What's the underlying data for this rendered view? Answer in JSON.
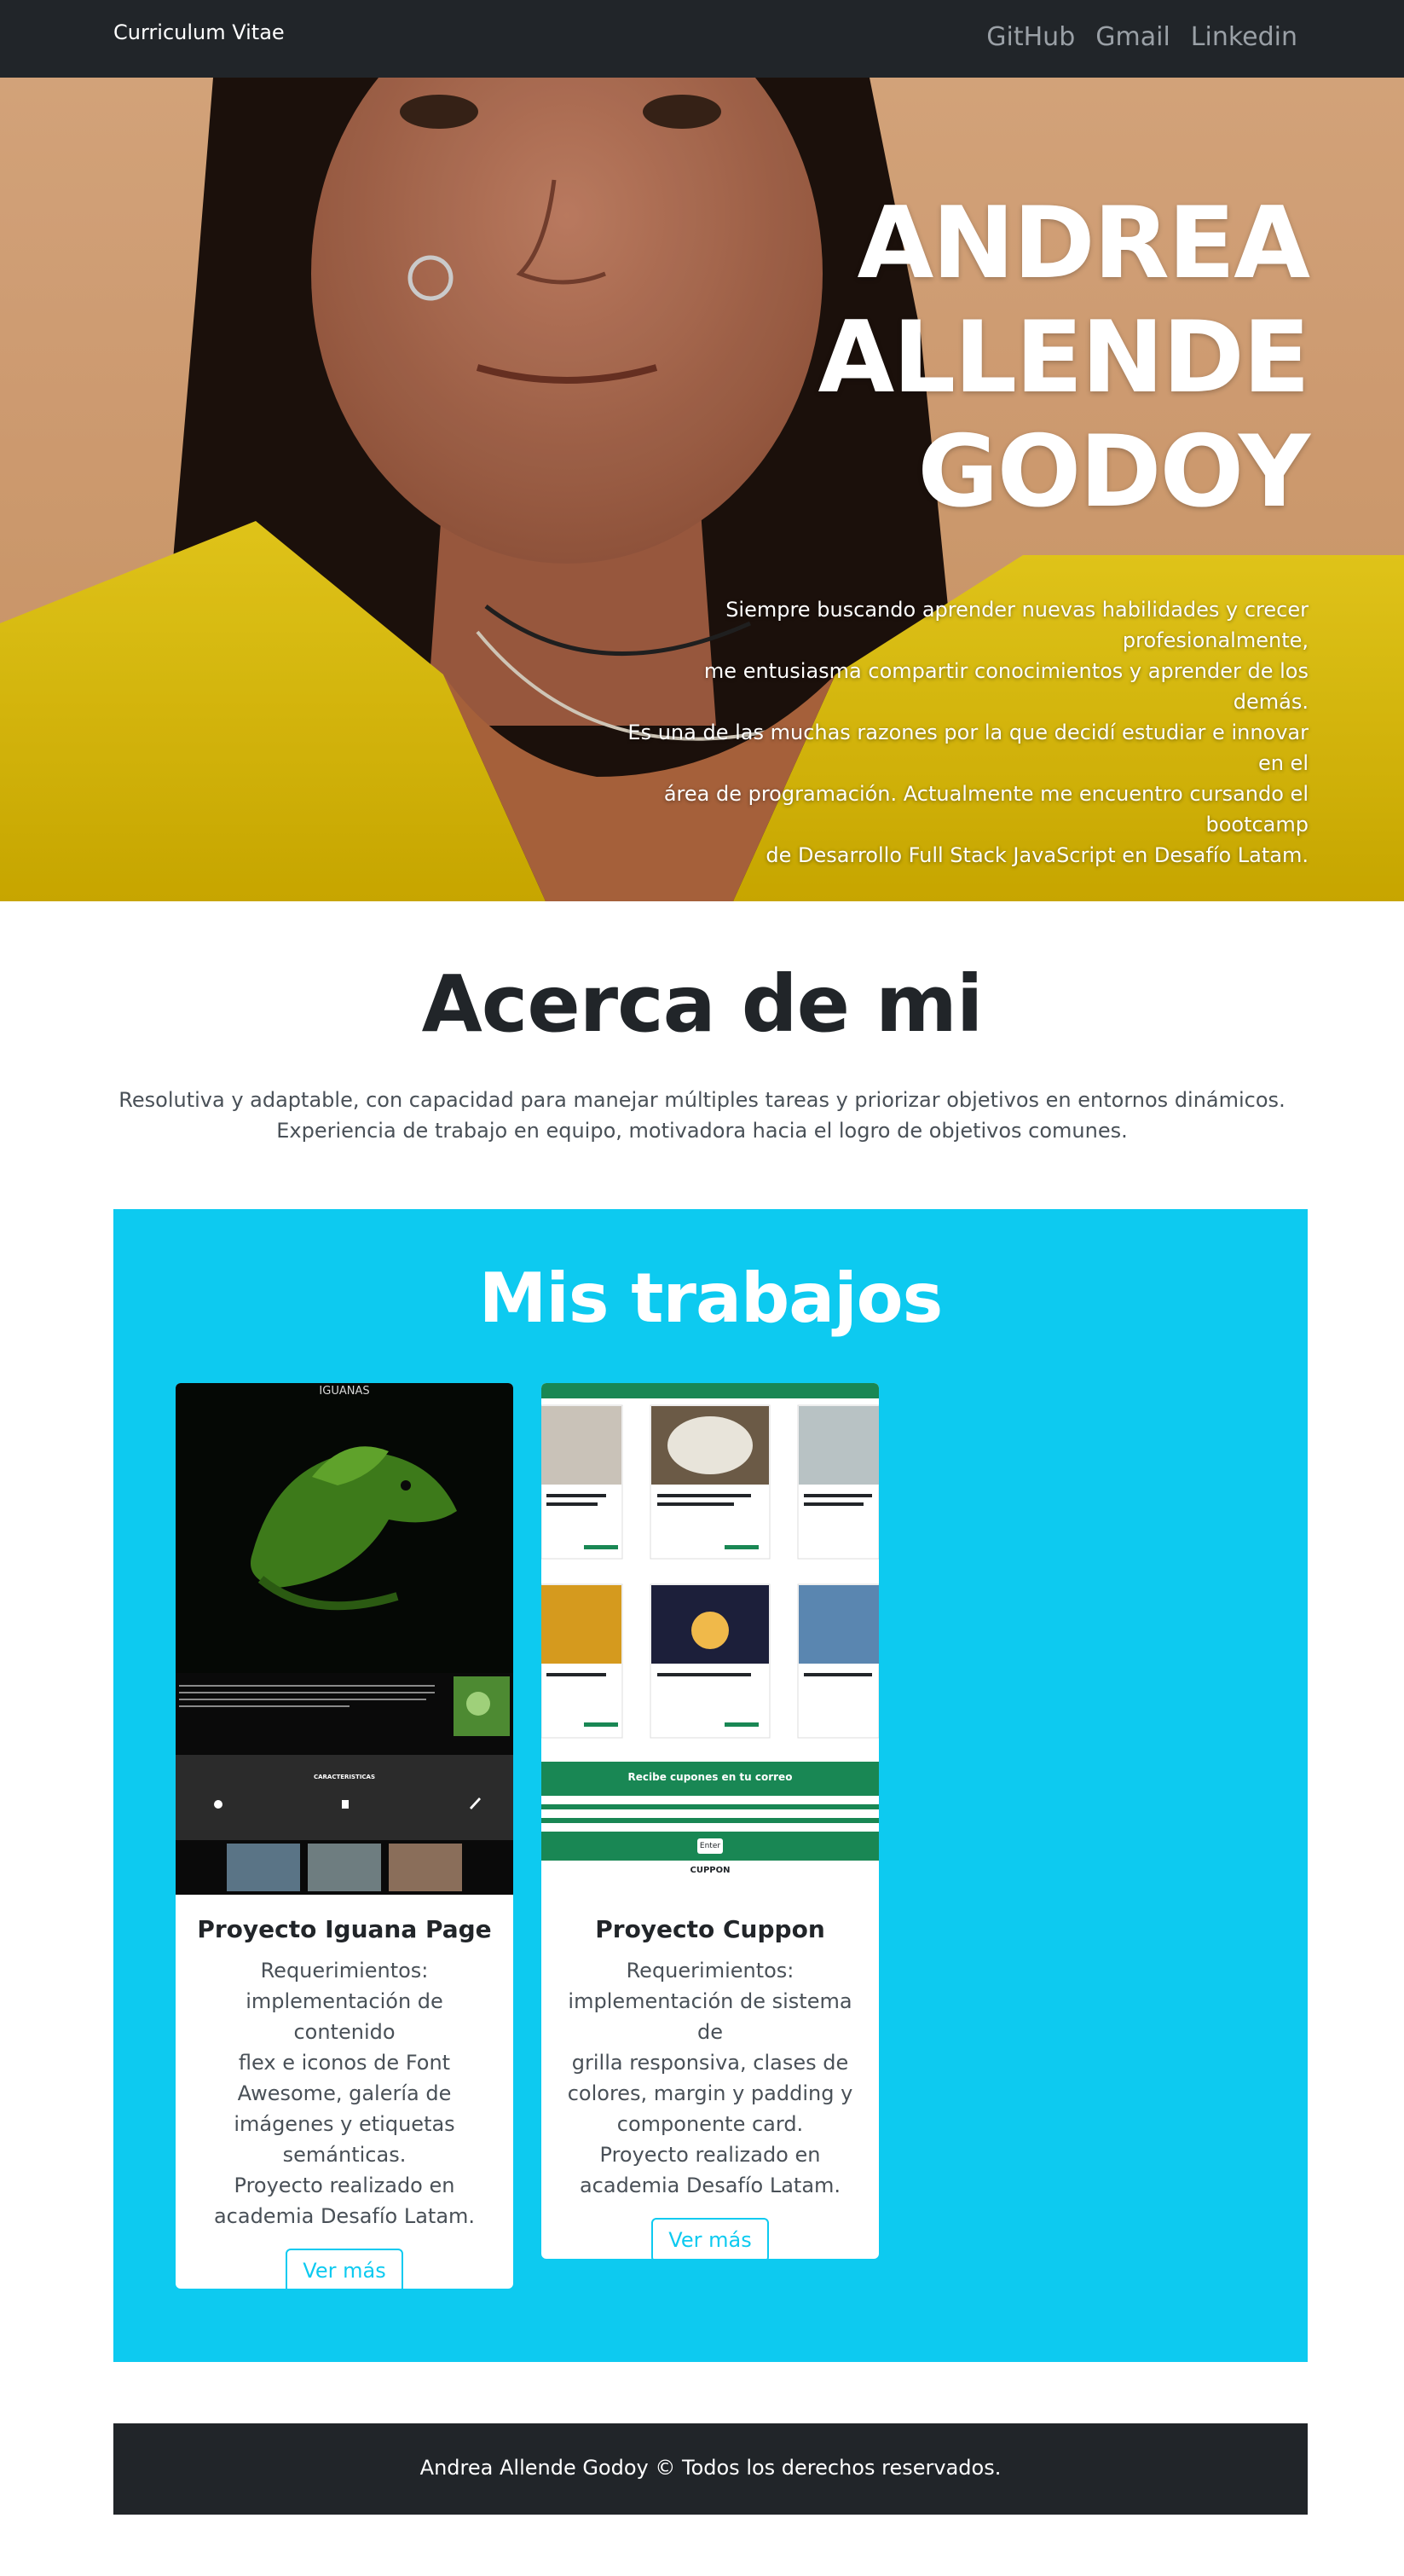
{
  "navbar": {
    "brand": "Curriculum Vitae",
    "links": [
      "GitHub",
      "Gmail",
      "Linkedin"
    ]
  },
  "hero": {
    "title_lines": [
      "ANDREA",
      "ALLENDE",
      "GODOY"
    ],
    "description_lines": [
      "Siempre buscando aprender nuevas habilidades y crecer",
      "profesionalmente,",
      "me entusiasma compartir conocimientos y aprender de los demás.",
      "Es una de las muchas razones por la que decidí estudiar e innovar en el",
      "área de programación. Actualmente me encuentro cursando el bootcamp",
      "de Desarrollo Full Stack JavaScript en Desafío Latam."
    ]
  },
  "about": {
    "title": "Acerca de mi",
    "lines": [
      "Resolutiva y adaptable, con capacidad para manejar múltiples tareas y priorizar objetivos en entornos dinámicos.",
      "Experiencia de trabajo en equipo, motivadora hacia el logro de objetivos comunes."
    ]
  },
  "works": {
    "title": "Mis trabajos",
    "cards": [
      {
        "thumb_label": "IGUANAS",
        "thumb_section": "CARACTERISTICAS",
        "title": "Proyecto Iguana Page",
        "text_lines": [
          "Requerimientos:",
          "implementación de contenido",
          "flex e iconos de Font",
          "Awesome, galería de",
          "imágenes y etiquetas",
          "semánticas.",
          "Proyecto realizado en",
          "academia Desafío Latam."
        ],
        "button": "Ver más"
      },
      {
        "thumb_band_1": "Recibe cupones en tu correo",
        "thumb_button": "Enter",
        "thumb_footer": "CUPPON",
        "title": "Proyecto Cuppon",
        "text_lines": [
          "Requerimientos:",
          "implementación de sistema de",
          "grilla responsiva, clases de",
          "colores, margin y padding y",
          "componente card.",
          "Proyecto realizado en",
          "academia Desafío Latam."
        ],
        "button": "Ver más"
      }
    ]
  },
  "footer": {
    "text": "Andrea Allende Godoy © Todos los derechos reservados."
  },
  "colors": {
    "navbar": "#212529",
    "accent": "#0dcaf0",
    "footer": "#212529"
  }
}
